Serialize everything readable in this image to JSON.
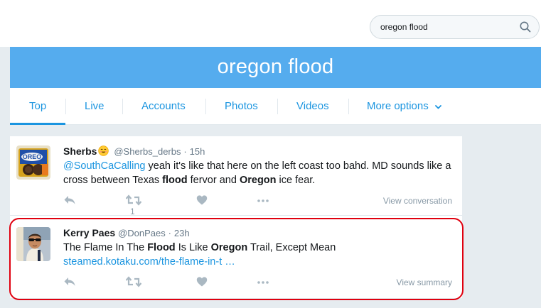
{
  "search": {
    "query": "oregon flood"
  },
  "banner": {
    "title": "oregon flood"
  },
  "tabs": [
    {
      "label": "Top"
    },
    {
      "label": "Live"
    },
    {
      "label": "Accounts"
    },
    {
      "label": "Photos"
    },
    {
      "label": "Videos"
    },
    {
      "label": "More options"
    }
  ],
  "tweets": [
    {
      "name": "Sherbs",
      "handle": "@Sherbs_derbs",
      "dot": "·",
      "time": "15h",
      "mention": "@SouthCaCalling",
      "text_1": " yeah it's like that here on the left coast too bahd. MD sounds like a cross between Texas ",
      "bold_1": "flood",
      "text_2": " fervor and ",
      "bold_2": "Oregon",
      "text_3": " ice fear.",
      "retweet_count": "1",
      "side_link": "View conversation"
    },
    {
      "name": "Kerry Paes",
      "handle": "@DonPaes",
      "dot": "·",
      "time": "23h",
      "text_1": "The Flame In The ",
      "bold_1": "Flood",
      "text_2": " Is Like ",
      "bold_2": "Oregon",
      "text_3": " Trail, Except Mean",
      "url": "steamed.kotaku.com/the-flame-in-t …",
      "side_link": "View summary"
    }
  ],
  "icons": {
    "search": "search-icon",
    "reply": "reply-icon",
    "retweet": "retweet-icon",
    "like": "heart-icon",
    "more": "more-dots-icon",
    "chevron": "chevron-down-icon",
    "emoji": "smiling-face-emoji"
  },
  "colors": {
    "brand_blue": "#55acee",
    "link_blue": "#1b95e0",
    "highlight_red": "#e0000f",
    "background": "#e6ecf0"
  }
}
